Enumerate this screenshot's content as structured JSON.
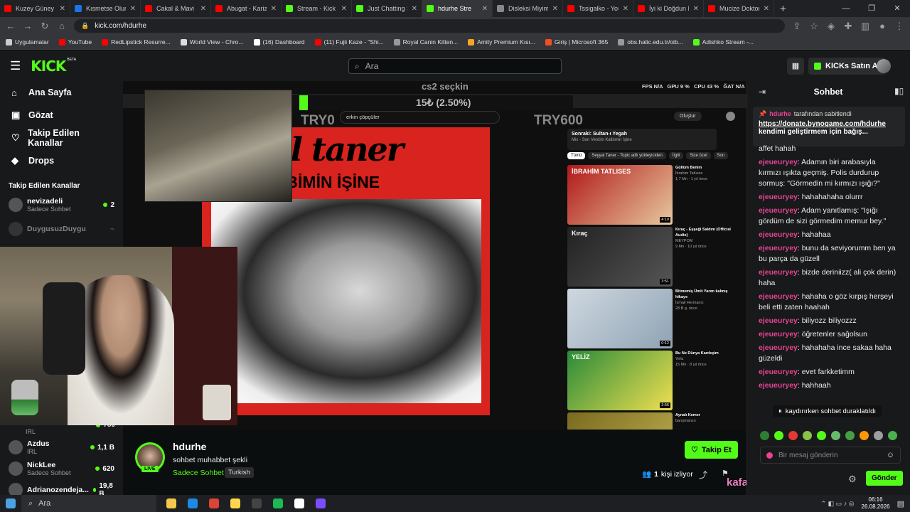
{
  "browser": {
    "tabs": [
      {
        "title": "Kuzey Güney 11.",
        "color": "#ff0000"
      },
      {
        "title": "Kısmetse Olur: A",
        "color": "#1a73e8"
      },
      {
        "title": "Cakal & Mavi -",
        "color": "#ff0000"
      },
      {
        "title": "Abugat - Karizm",
        "color": "#ff0000"
      },
      {
        "title": "Stream - Kick D",
        "color": "#53fc18"
      },
      {
        "title": "Just Chatting St",
        "color": "#53fc18"
      },
      {
        "title": "hdurhe Stre",
        "color": "#53fc18"
      },
      {
        "title": "Disleksi Miyim",
        "color": "#888888"
      },
      {
        "title": "Tssigalko - YouT",
        "color": "#ff0000"
      },
      {
        "title": "İyi ki Doğdun Ir",
        "color": "#ff0000"
      },
      {
        "title": "Mucize Doktor",
        "color": "#ff0000"
      }
    ],
    "active_tab_index": 6,
    "url": "kick.com/hdurhe",
    "bookmarks": [
      {
        "label": "Uygulamalar",
        "color": "#cccccc"
      },
      {
        "label": "YouTube",
        "color": "#ff0000"
      },
      {
        "label": "RedLipstick Resurre...",
        "color": "#ff0000"
      },
      {
        "label": "World View - Chro...",
        "color": "#dddddd"
      },
      {
        "label": "(16) Dashboard",
        "color": "#ffffff"
      },
      {
        "label": "(11) Fujii Kaze - \"Shi...",
        "color": "#ff0000"
      },
      {
        "label": "Royal Canin Kitten...",
        "color": "#999999"
      },
      {
        "label": "Amity Premium Kısı...",
        "color": "#f5a623"
      },
      {
        "label": "Giriş | Microsoft 365",
        "color": "#f25022"
      },
      {
        "label": "obs.halic.edu.tr/oib...",
        "color": "#999999"
      },
      {
        "label": "Adishko Stream -...",
        "color": "#53fc18"
      }
    ]
  },
  "header": {
    "logo": "KICK",
    "logo_badge": "BETA",
    "search_placeholder": "Ara",
    "buy_kicks": "KICKs Satın Al"
  },
  "sidebar": {
    "nav": [
      {
        "label": "Ana Sayfa",
        "icon": "home-icon"
      },
      {
        "label": "Gözat",
        "icon": "browse-icon"
      },
      {
        "label": "Takip Edilen Kanallar",
        "icon": "heart-icon"
      },
      {
        "label": "Drops",
        "icon": "drops-icon"
      }
    ],
    "followed_title": "Takip Edilen Kanallar",
    "followed": [
      {
        "name": "nevizadeli",
        "sub": "Sadece Sohbet",
        "viewers": "2",
        "live": true
      },
      {
        "name": "DuygusuzDuygu",
        "sub": "",
        "viewers": "",
        "live": false
      }
    ],
    "recommended": [
      {
        "name": "Azdus",
        "sub": "IRL",
        "viewers": "1,1 B"
      },
      {
        "name": "NickLee",
        "sub": "Sadece Sohbet",
        "viewers": "620"
      },
      {
        "name": "Adrianozendeja...",
        "sub": "",
        "viewers": "19,8 B"
      }
    ],
    "partial_item": {
      "sub": "IRL",
      "viewers": "780"
    }
  },
  "stream_overlay": {
    "scene_title": "cs2 seçkin",
    "donation_amount": "15₺ (2.50%)",
    "try_left": "TRY0",
    "try_right": "TRY600",
    "stats": "FPS N/A   GPU 9 %   CPU 43 %   ĞAT N/A",
    "yt_search": "erkin çöpçüler",
    "album_line1": "eyyal taner",
    "album_line2": "RDİM KALBİMİN İŞİNE",
    "up_next": "Sonraki: Sultan-ı Yegah",
    "up_next_sub": "Mix - Son Verdim Kalbimin İşine",
    "chips": [
      "Tümü",
      "Seyyal Taner - Topic adlı yükleyiciden",
      "İlgili",
      "Size özel",
      "Son"
    ],
    "videos": [
      {
        "title": "Güllüm Benim",
        "channel": "İbrahim Tatlıses",
        "meta": "1,7 Mn · 1 yıl önce",
        "dur": "4:10",
        "thumb_text": "İBRAHİM TATLISES"
      },
      {
        "title": "Kıraç - Eşşeği Saldım (Official Audio)",
        "channel": "MEYPOM",
        "meta": "9 Mn · 10 yıl önce",
        "dur": "3:51",
        "thumb_text": "Kıraç"
      },
      {
        "title": "Bitmemiş Ümit Yarım kalmış hikaye",
        "channel": "İsmail Hermanci",
        "meta": "28 B g. önce",
        "dur": "0:12",
        "thumb_text": ""
      },
      {
        "title": "Bu Ne Dünya Kardeşim",
        "channel": "Yeliz",
        "meta": "15 Mn · 8 yıl önce",
        "dur": "3:56",
        "thumb_text": "YELİZ"
      },
      {
        "title": "Aynalı Kemer",
        "channel": "barışmanco",
        "meta": "",
        "dur": "",
        "thumb_text": ""
      }
    ],
    "oylar_button": "Oluştur"
  },
  "stream_info": {
    "channel": "hdurhe",
    "live_badge": "LIVE",
    "title": "sohbet muhabbet şekli",
    "category": "Sadece Sohbet",
    "language": "Turkish",
    "viewer_count": "1",
    "viewer_label": "kişi izliyor",
    "follow_button": "Takip Et",
    "overlay_text": "kafanikaldir : valla"
  },
  "chat": {
    "title": "Sohbet",
    "pinned_by": "hdurhe",
    "pinned_label": "tarafından sabitlendi",
    "pinned_link": "https://donate.bynogame.com/hdurhe",
    "pinned_text": "kendimi geliştirmem için bağış...",
    "messages": [
      {
        "user": "",
        "text": "affet hahah"
      },
      {
        "user": "ejeueuryey",
        "text": "Adamın biri arabasıyla kırmızı ışıkta geçmiş. Polis durdurup sormuş: \"Görmedin mi kırmızı ışığı?\""
      },
      {
        "user": "ejeueuryey",
        "text": "hahahahaha olurrr"
      },
      {
        "user": "ejeueuryey",
        "text": "Adam yanıtlamış: \"Işığı gördüm de sizi görmedim memur bey.\""
      },
      {
        "user": "ejeueuryey",
        "text": "hahahaa"
      },
      {
        "user": "ejeueuryey",
        "text": "bunu da seviyorumm ben ya bu parça da güzell"
      },
      {
        "user": "ejeueuryey",
        "text": "bizde deriniizz( ali çok derin) haha"
      },
      {
        "user": "ejeueuryey",
        "text": "hahaha o göz kırpış herşeyi beli etti zaten haahah"
      },
      {
        "user": "ejeueuryey",
        "text": "biliyozz biliyozzz"
      },
      {
        "user": "ejeueuryey",
        "text": "öğretenler sağolsun"
      },
      {
        "user": "ejeueuryey",
        "text": "hahahaha ince sakaa haha güzeldi"
      },
      {
        "user": "ejeueuryey",
        "text": "evet farkketimm"
      },
      {
        "user": "ejeueuryey",
        "text": "hahhaah"
      }
    ],
    "paused_notice": "kaydırırken sohbet duraklatıldı",
    "input_placeholder": "Bir mesaj gönderin",
    "send_button": "Gönder"
  },
  "taskbar": {
    "search_placeholder": "Ara",
    "time": "06:16",
    "date": "26.08.2026"
  }
}
